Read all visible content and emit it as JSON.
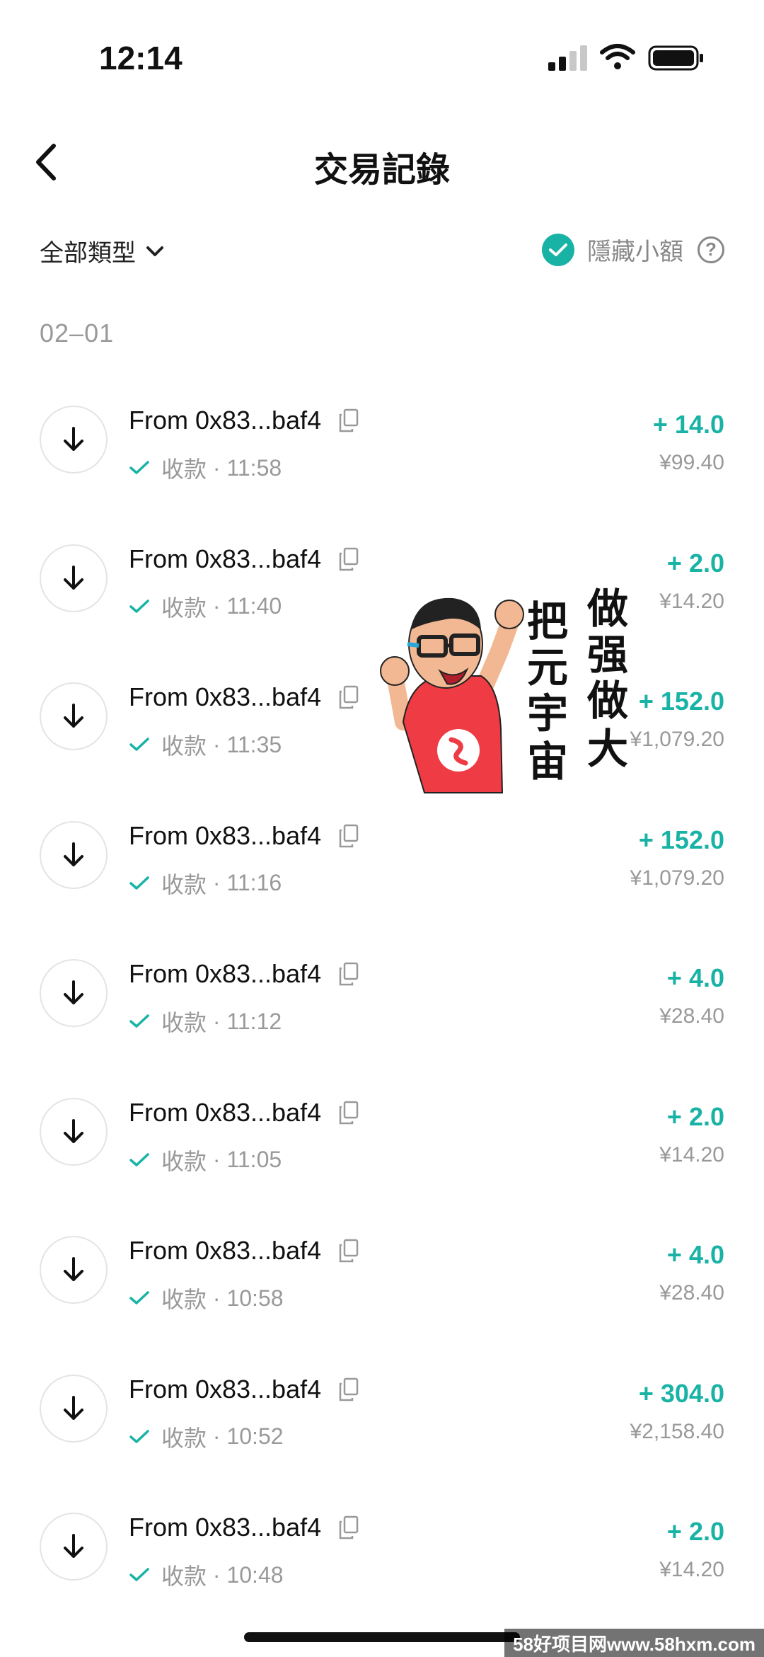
{
  "status_bar": {
    "time": "12:14"
  },
  "header": {
    "title": "交易記錄"
  },
  "filter": {
    "type_label": "全部類型",
    "hide_small_label": "隱藏小額",
    "help_glyph": "?"
  },
  "date_group": "02–01",
  "transactions": [
    {
      "from": "From 0x83...baf4",
      "status": "收款",
      "time": "11:58",
      "amount": "+ 14.0",
      "fiat": "¥99.40"
    },
    {
      "from": "From 0x83...baf4",
      "status": "收款",
      "time": "11:40",
      "amount": "+ 2.0",
      "fiat": "¥14.20"
    },
    {
      "from": "From 0x83...baf4",
      "status": "收款",
      "time": "11:35",
      "amount": "+ 152.0",
      "fiat": "¥1,079.20"
    },
    {
      "from": "From 0x83...baf4",
      "status": "收款",
      "time": "11:16",
      "amount": "+ 152.0",
      "fiat": "¥1,079.20"
    },
    {
      "from": "From 0x83...baf4",
      "status": "收款",
      "time": "11:12",
      "amount": "+ 4.0",
      "fiat": "¥28.40"
    },
    {
      "from": "From 0x83...baf4",
      "status": "收款",
      "time": "11:05",
      "amount": "+ 2.0",
      "fiat": "¥14.20"
    },
    {
      "from": "From 0x83...baf4",
      "status": "收款",
      "time": "10:58",
      "amount": "+ 4.0",
      "fiat": "¥28.40"
    },
    {
      "from": "From 0x83...baf4",
      "status": "收款",
      "time": "10:52",
      "amount": "+ 304.0",
      "fiat": "¥2,158.40"
    },
    {
      "from": "From 0x83...baf4",
      "status": "收款",
      "time": "10:48",
      "amount": "+ 2.0",
      "fiat": "¥14.20"
    }
  ],
  "sticker": {
    "text_lines": [
      "做",
      "强",
      "做",
      "大",
      "把",
      "元",
      "宇",
      "宙"
    ]
  },
  "watermark": "58好项目网www.58hxm.com",
  "colors": {
    "accent": "#19b3a6",
    "muted": "#999999",
    "text": "#111111"
  },
  "icons": {
    "back": "chevron-left-icon",
    "dropdown": "chevron-down-icon",
    "receive": "arrow-down-icon",
    "copy": "copy-icon",
    "status": "check-icon",
    "help": "question-circle-icon"
  }
}
